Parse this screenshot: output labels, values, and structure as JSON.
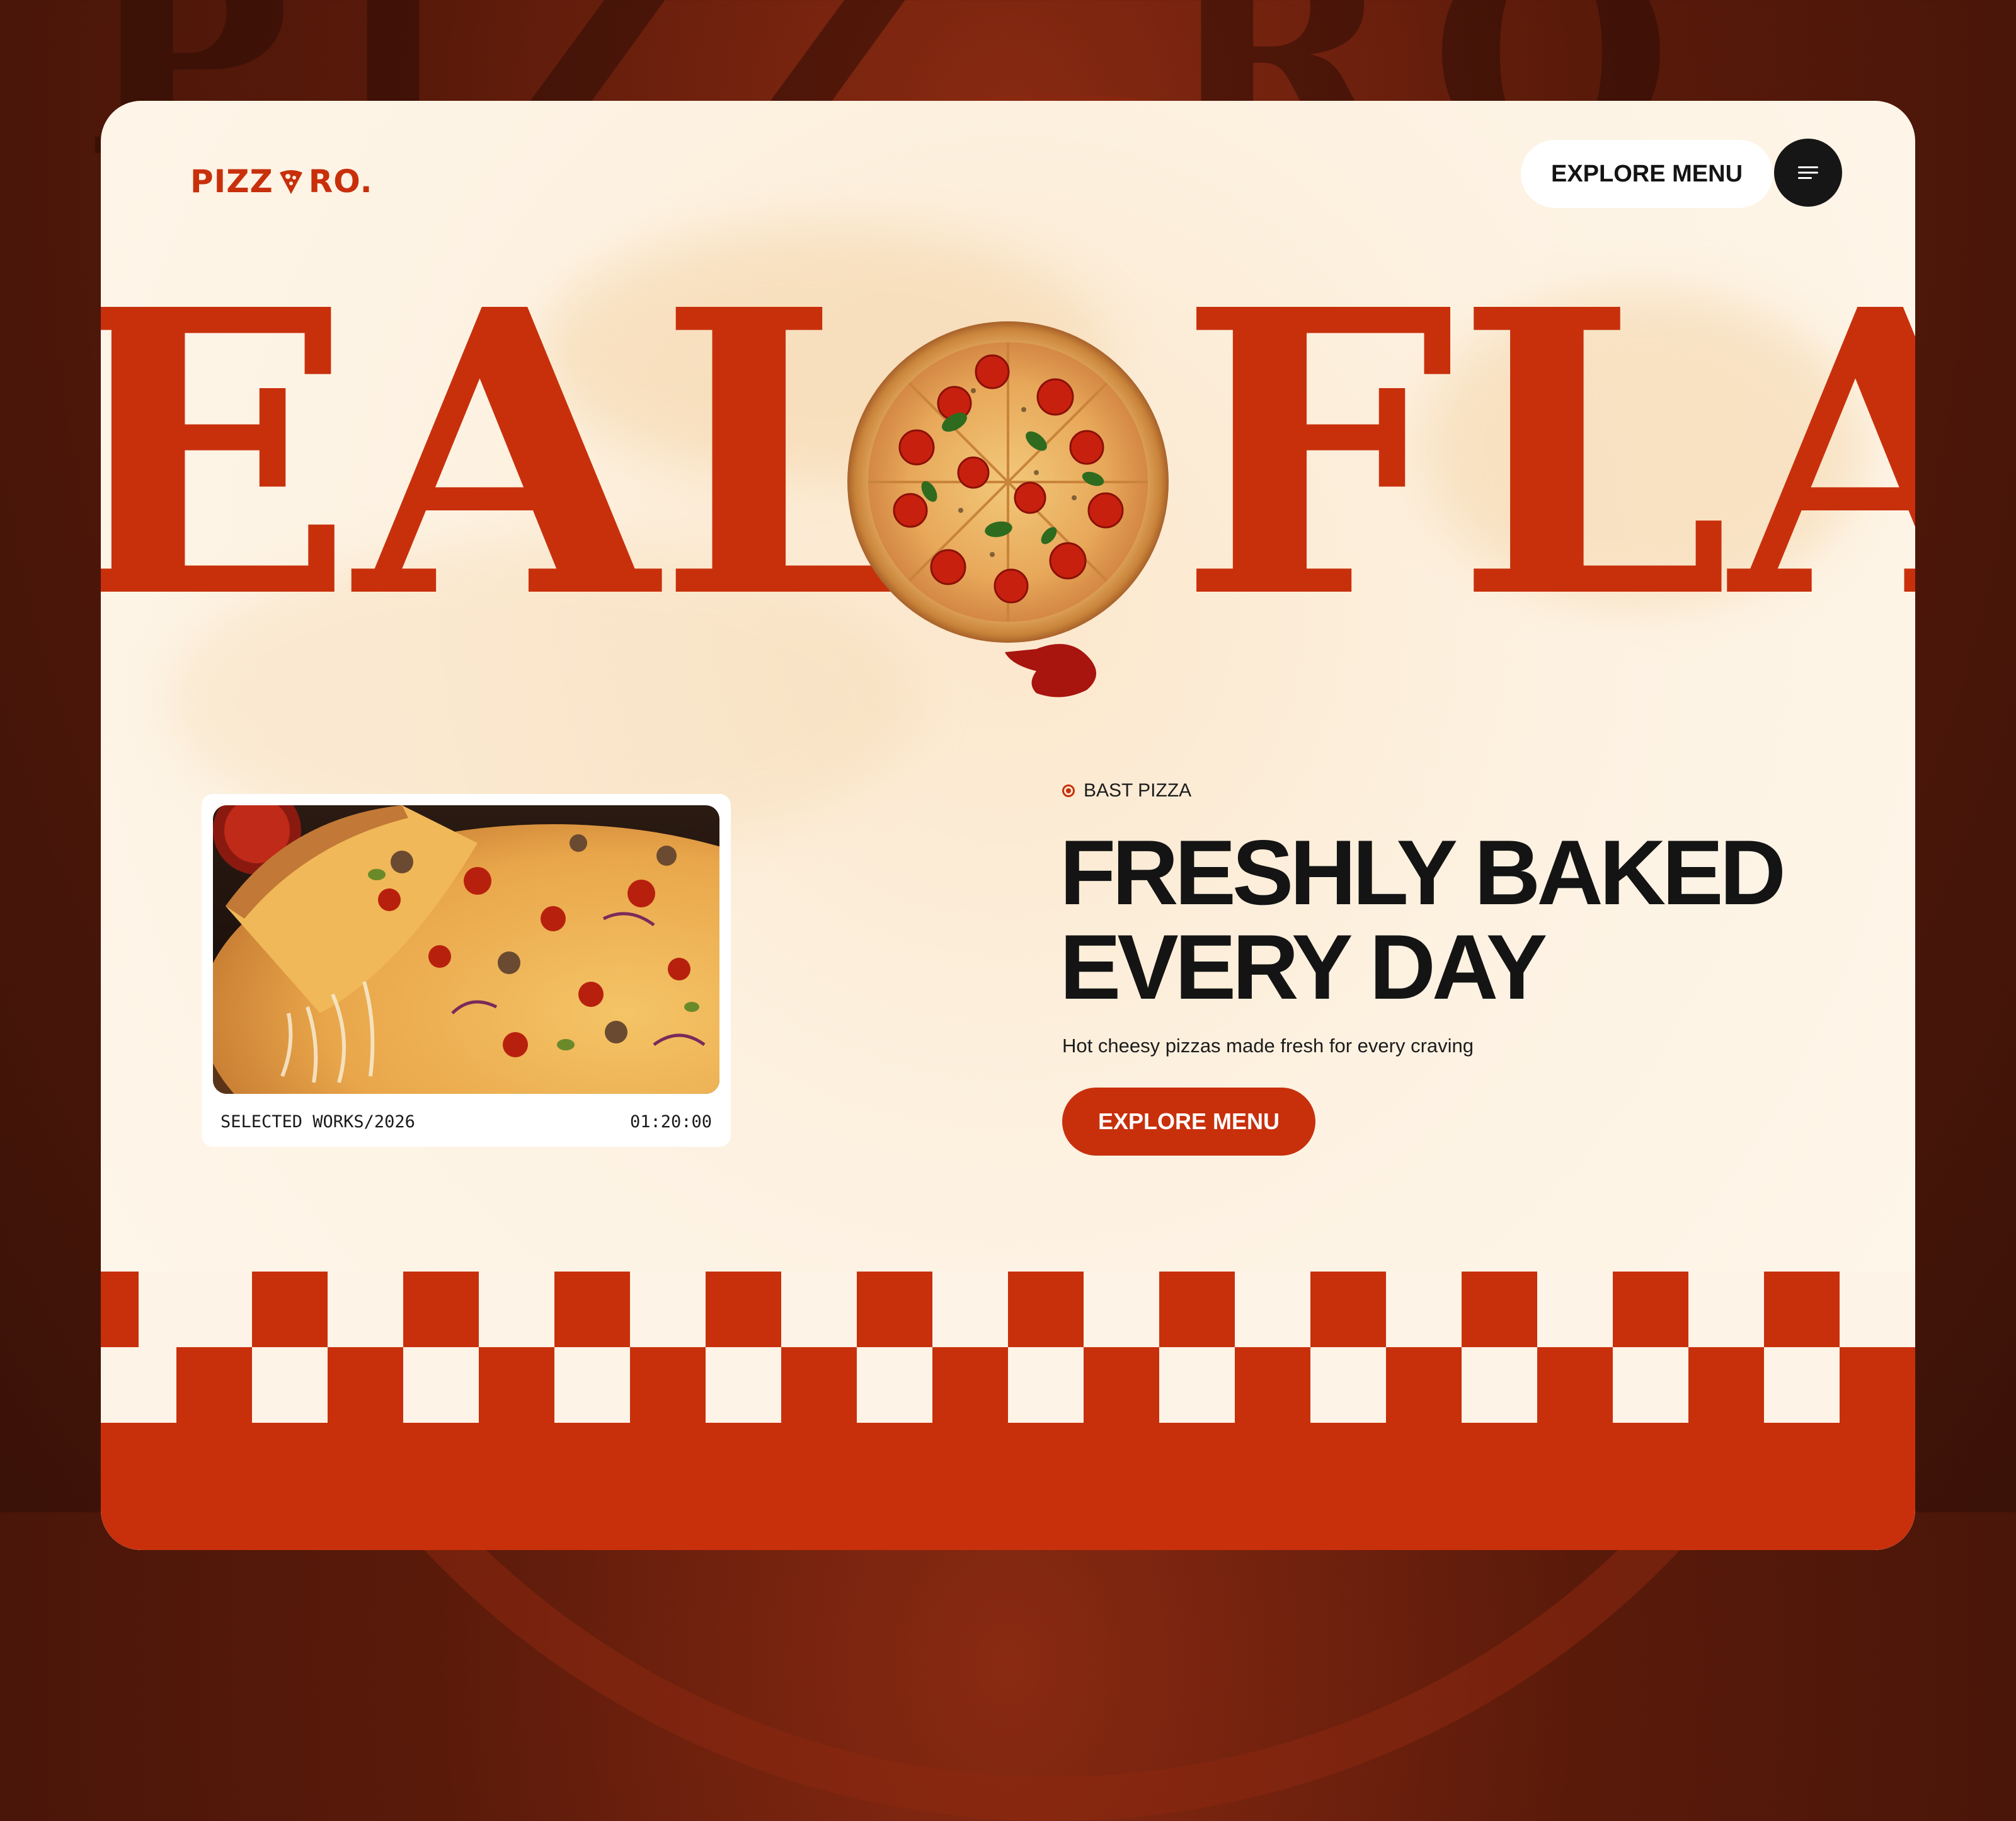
{
  "brand": {
    "name_left": "PIZZ",
    "name_right": "RO.",
    "accent": "#c8300c",
    "dark": "#141414"
  },
  "header": {
    "explore_label": "EXPLORE MENU",
    "menu_icon": "hamburger-icon"
  },
  "hero": {
    "marquee_left": "EAL",
    "marquee_right": "FLA"
  },
  "feature_card": {
    "caption_left": "SELECTED WORKS/2026",
    "caption_right": "01:20:00"
  },
  "content": {
    "eyebrow": "BAST PIZZA",
    "headline_line1": "FRESHLY BAKED",
    "headline_line2": "EVERY DAY",
    "subtext": "Hot cheesy pizzas made fresh for every craving",
    "cta_label": "EXPLORE MENU"
  }
}
